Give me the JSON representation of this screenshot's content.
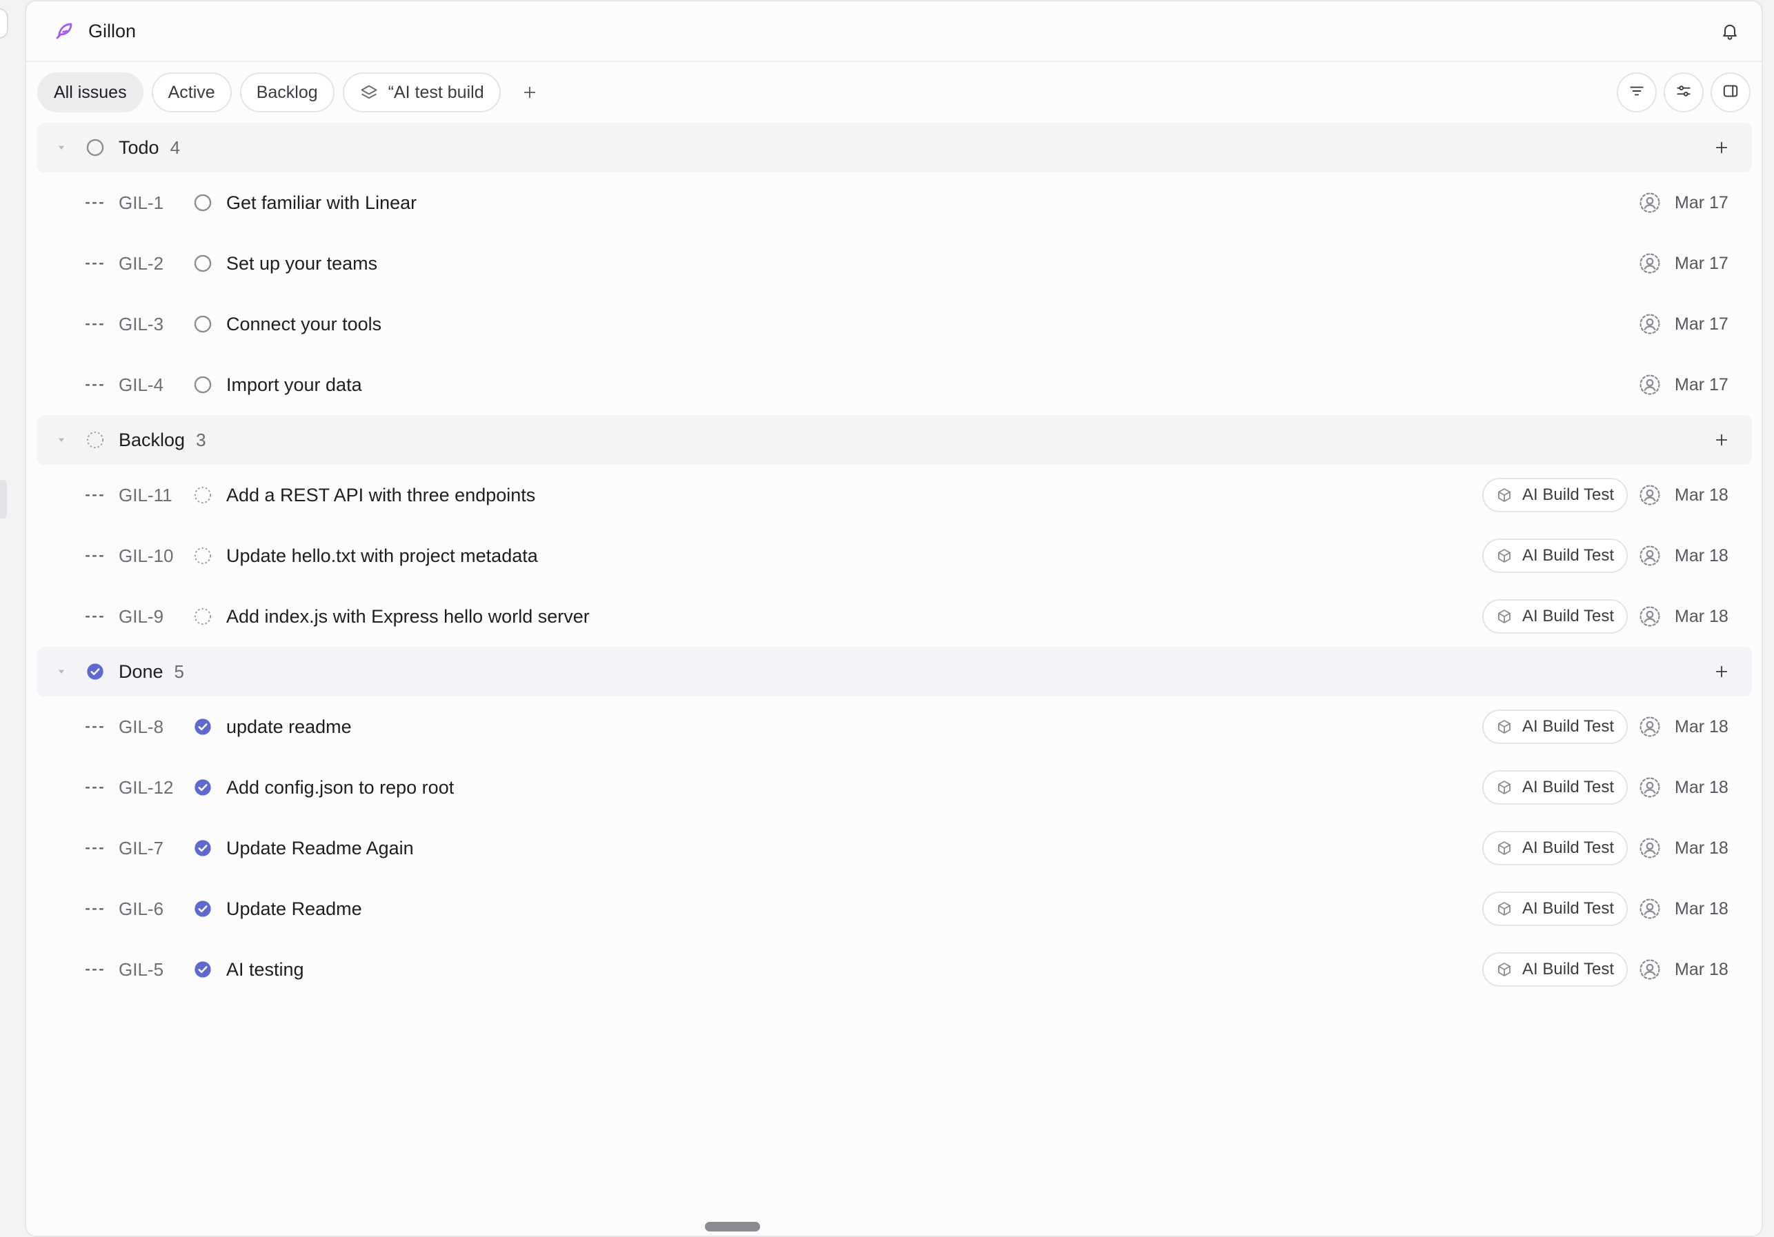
{
  "header": {
    "title": "Gillon",
    "logo_icon": "feather-icon",
    "bell_icon": "bell-icon"
  },
  "toolbar": {
    "views": [
      {
        "label": "All issues",
        "active": true
      },
      {
        "label": "Active",
        "active": false
      },
      {
        "label": "Backlog",
        "active": false
      },
      {
        "label": "“AI test build",
        "active": false,
        "icon": "layers-icon"
      }
    ],
    "add_view_icon": "plus-icon",
    "right_buttons": [
      "filter-icon",
      "display-options-icon",
      "sidebar-toggle-icon"
    ]
  },
  "colors": {
    "accent": "#5e6ad2",
    "logo": "#a259ff",
    "muted": "#8b8b93"
  },
  "groups": [
    {
      "name": "Todo",
      "count": "4",
      "status": "todo",
      "issues": [
        {
          "id": "GIL-1",
          "title": "Get familiar with Linear",
          "project": "",
          "date": "Mar 17"
        },
        {
          "id": "GIL-2",
          "title": "Set up your teams",
          "project": "",
          "date": "Mar 17"
        },
        {
          "id": "GIL-3",
          "title": "Connect your tools",
          "project": "",
          "date": "Mar 17"
        },
        {
          "id": "GIL-4",
          "title": "Import your data",
          "project": "",
          "date": "Mar 17"
        }
      ]
    },
    {
      "name": "Backlog",
      "count": "3",
      "status": "backlog",
      "issues": [
        {
          "id": "GIL-11",
          "title": "Add a REST API with three endpoints",
          "project": "AI Build Test",
          "date": "Mar 18"
        },
        {
          "id": "GIL-10",
          "title": "Update hello.txt with project metadata",
          "project": "AI Build Test",
          "date": "Mar 18"
        },
        {
          "id": "GIL-9",
          "title": "Add index.js with Express hello world server",
          "project": "AI Build Test",
          "date": "Mar 18"
        }
      ]
    },
    {
      "name": "Done",
      "count": "5",
      "status": "done",
      "issues": [
        {
          "id": "GIL-8",
          "title": "update readme",
          "project": "AI Build Test",
          "date": "Mar 18"
        },
        {
          "id": "GIL-12",
          "title": "Add config.json to repo root",
          "project": "AI Build Test",
          "date": "Mar 18"
        },
        {
          "id": "GIL-7",
          "title": "Update Readme Again",
          "project": "AI Build Test",
          "date": "Mar 18"
        },
        {
          "id": "GIL-6",
          "title": "Update Readme",
          "project": "AI Build Test",
          "date": "Mar 18"
        },
        {
          "id": "GIL-5",
          "title": "AI testing",
          "project": "AI Build Test",
          "date": "Mar 18"
        }
      ]
    }
  ]
}
